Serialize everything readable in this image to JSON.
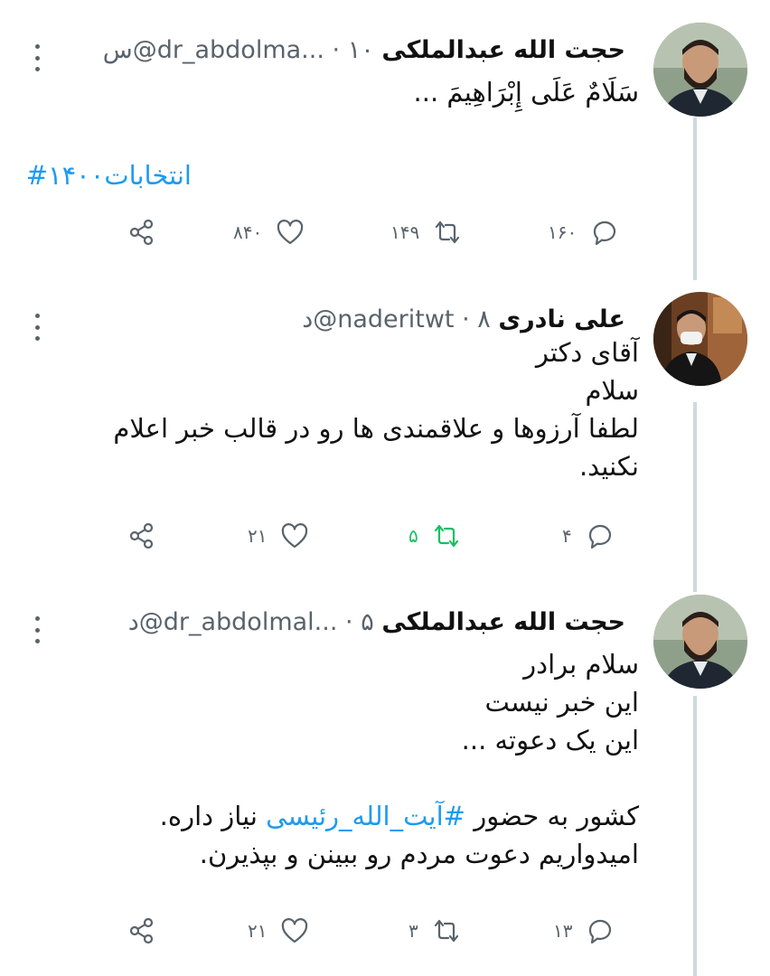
{
  "tweets": [
    {
      "author_name": "حجت الله عبدالملکی",
      "handle": "@dr_abdolma...",
      "separator": "·",
      "time": "۱۰س",
      "lines": [
        "سَلَامٌ عَلَی إِبْرَاهِیمَ ...",
        "",
        ""
      ],
      "hashtag": "انتخابات۱۴۰۰#",
      "replies": "۱۶۰",
      "retweets": "۱۴۹",
      "likes": "۸۴۰",
      "retweeted": false
    },
    {
      "author_name": "علی نادری",
      "handle": "@naderitwt",
      "separator": "·",
      "time": "۸د",
      "lines": [
        "آقای دکتر",
        "سلام",
        "لطفا آرزوها و علاقمندی ها رو در قالب خبر اعلام",
        "نکنید."
      ],
      "replies": "۴",
      "retweets": "۵",
      "likes": "۲۱",
      "retweeted": true
    },
    {
      "author_name": "حجت الله عبدالملکی",
      "handle": "@dr_abdolmal...",
      "separator": "·",
      "time": "۵د",
      "lines": [
        "سلام برادر",
        "این خبر نیست",
        "این یک دعوته ...",
        ""
      ],
      "line5_before": "کشور به حضور ",
      "line5_hashtag": "#آیت_الله_رئیسی",
      "line5_after": " نیاز داره.",
      "line6": "امیدواریم دعوت مردم رو ببینن و بپذیرن.",
      "replies": "۱۳",
      "retweets": "۳",
      "likes": "۲۱",
      "retweeted": false
    }
  ],
  "icons": {
    "reply": "reply-icon",
    "retweet": "retweet-icon",
    "like": "heart-icon",
    "share": "share-icon",
    "more": "more-vertical-icon"
  },
  "colors": {
    "link": "#1d9bf0",
    "retweet_active": "#17bf63",
    "secondary_text": "#59636b",
    "thread_line": "#cfd9de"
  }
}
